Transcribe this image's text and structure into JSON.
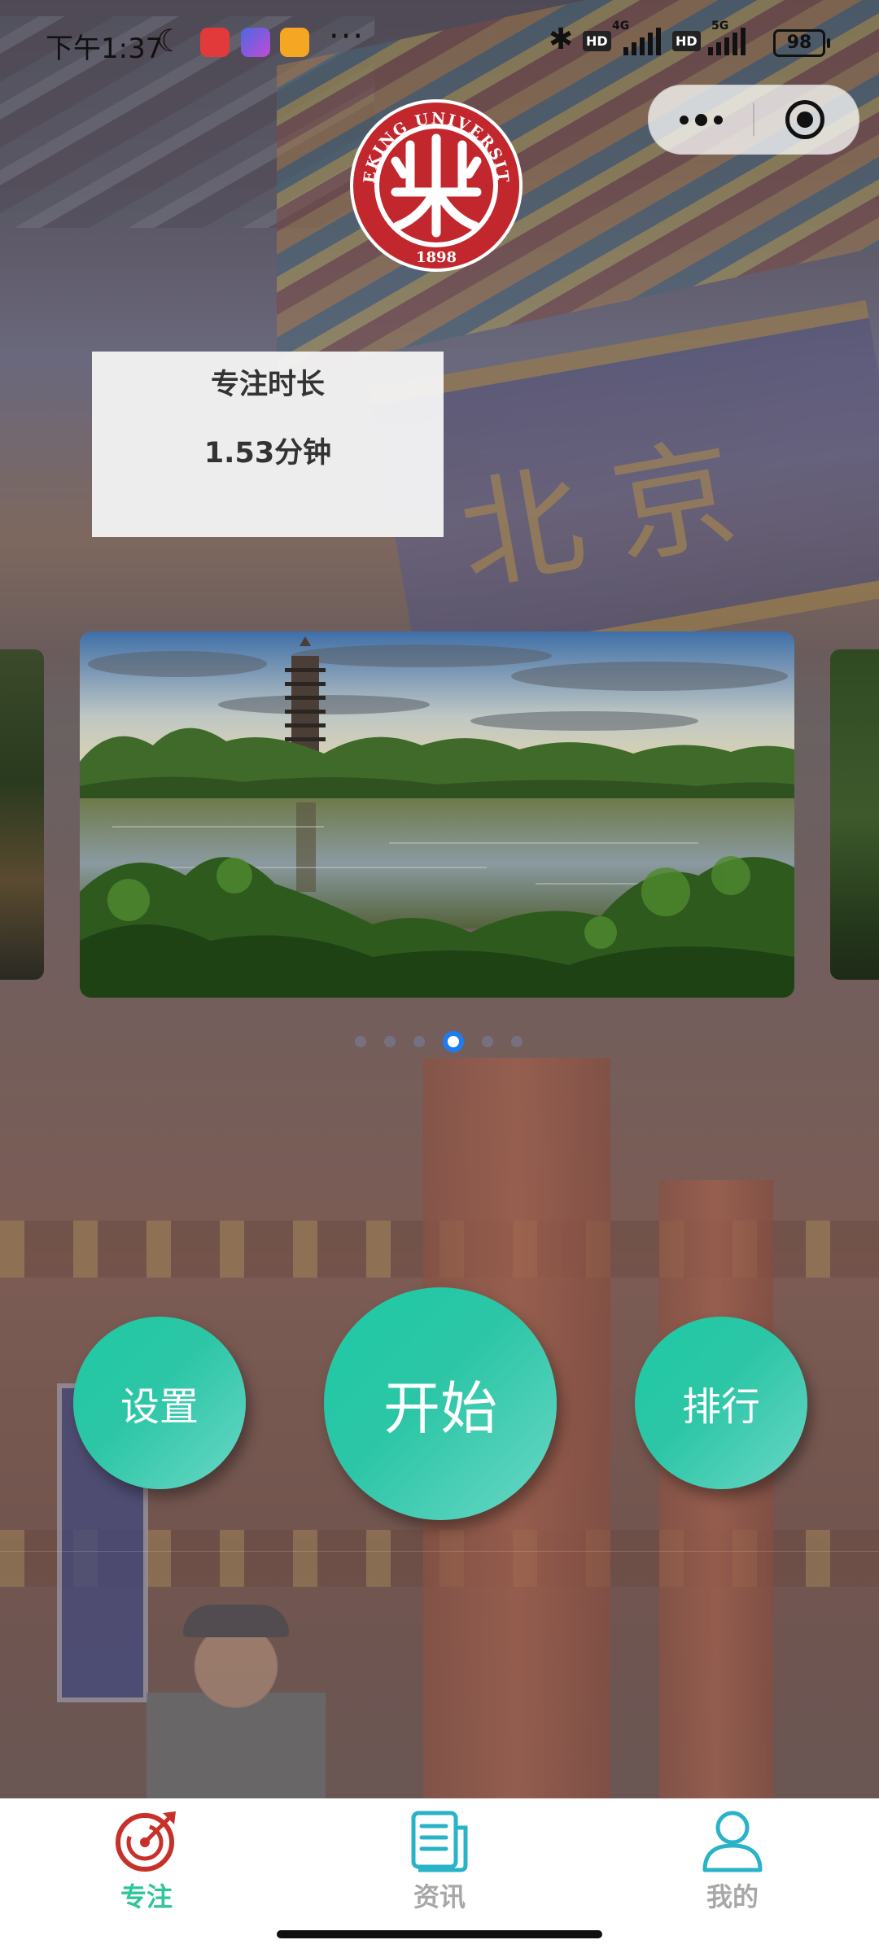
{
  "status_bar": {
    "time": "下午1:37",
    "network_4g": "4G",
    "network_5g": "5G",
    "hd": "HD",
    "battery": "98"
  },
  "focus": {
    "label": "专注时长",
    "value": "1.53分钟"
  },
  "carousel": {
    "total_dots": 6,
    "active_index": 3
  },
  "actions": {
    "settings_label": "设置",
    "start_label": "开始",
    "rank_label": "排行"
  },
  "tabs": [
    {
      "label": "专注",
      "icon": "target-icon",
      "active": true,
      "color": "#c8312a"
    },
    {
      "label": "资讯",
      "icon": "news-icon",
      "active": false,
      "color": "#29b3c8"
    },
    {
      "label": "我的",
      "icon": "user-icon",
      "active": false,
      "color": "#29b3c8"
    }
  ],
  "colors": {
    "accent_teal": "#1ec9a3",
    "active_dot": "#1e7cf0",
    "tab_active_text": "#2ec59b",
    "tab_inactive_text": "#a8a8a8",
    "logo_red": "#c1272d"
  },
  "logo": {
    "text": "PEKING UNIVERSITY",
    "year": "1898"
  }
}
